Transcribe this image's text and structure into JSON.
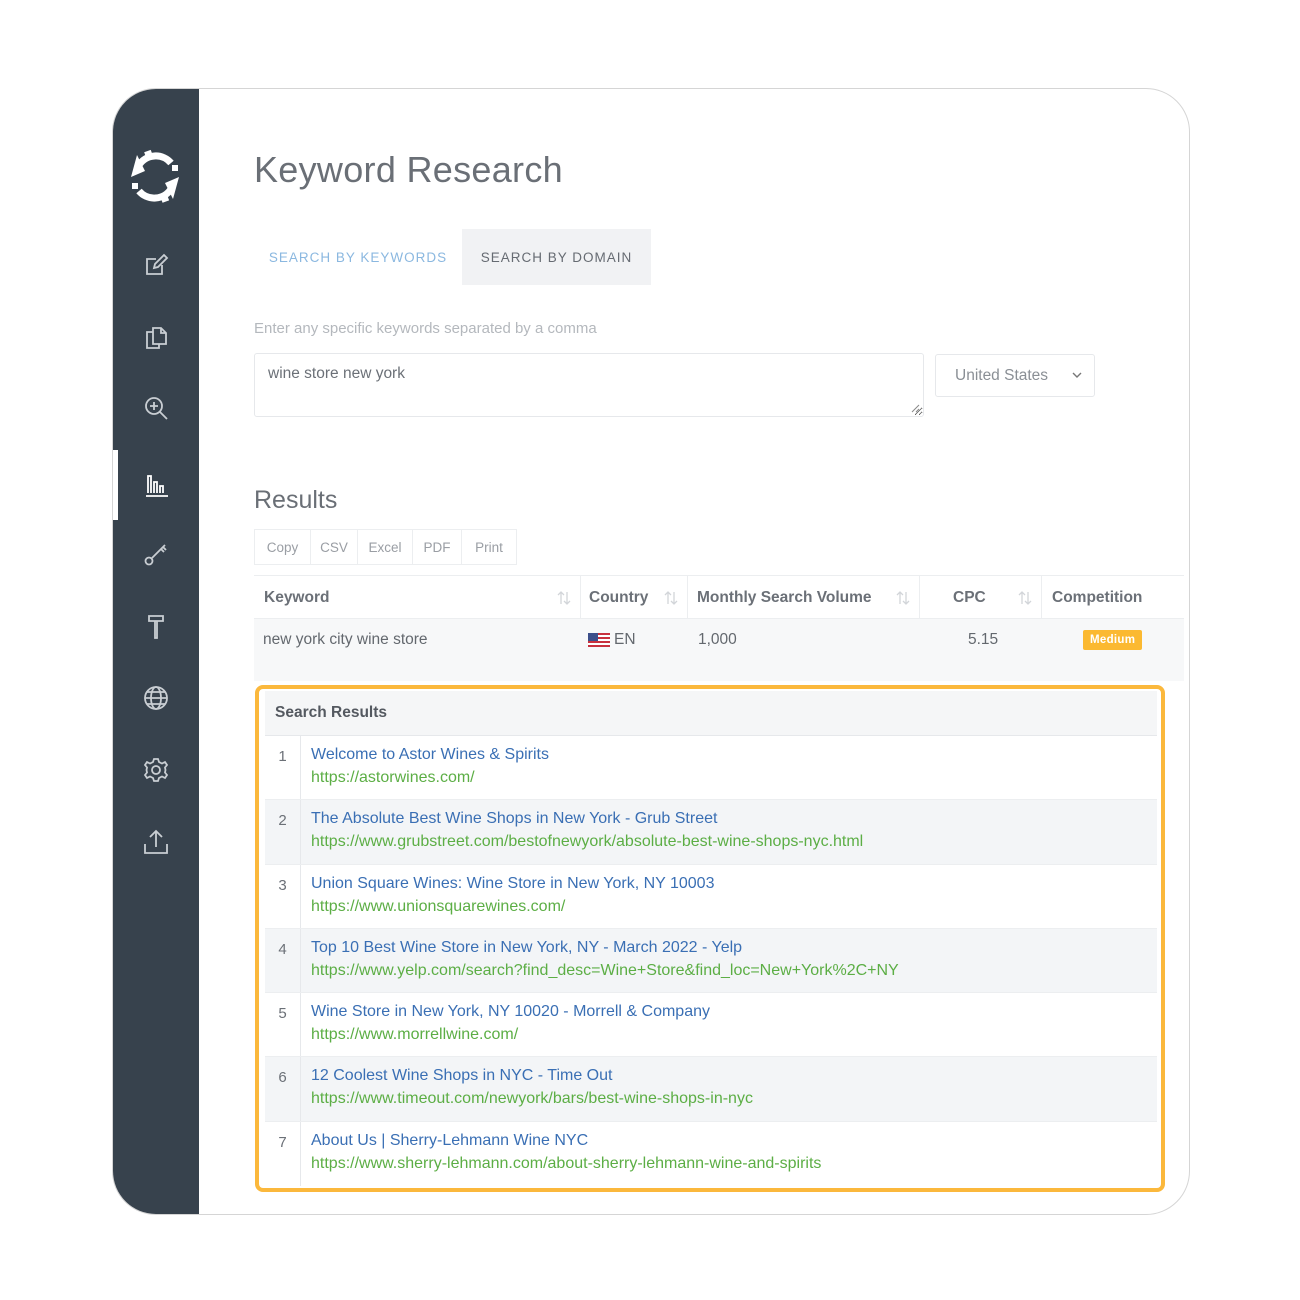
{
  "colors": {
    "sidebar_bg": "#37424d",
    "accent_link": "#3a6fb4",
    "url_green": "#5cae45",
    "highlight_border": "#fbb83c",
    "badge_medium": "#fbb931",
    "tab_active": "#8bb8e0"
  },
  "sidebar": {
    "logo_icon": "gear-sync-logo-icon",
    "items": [
      {
        "icon": "edit-icon",
        "active": false
      },
      {
        "icon": "copy-documents-icon",
        "active": false
      },
      {
        "icon": "zoom-in-icon",
        "active": false
      },
      {
        "icon": "bar-chart-icon",
        "active": true
      },
      {
        "icon": "key-icon",
        "active": false
      },
      {
        "icon": "hammer-icon",
        "active": false
      },
      {
        "icon": "globe-icon",
        "active": false
      },
      {
        "icon": "gear-icon",
        "active": false
      },
      {
        "icon": "upload-icon",
        "active": false
      }
    ]
  },
  "page": {
    "title": "Keyword Research",
    "tabs": [
      {
        "label": "SEARCH BY KEYWORDS",
        "active": true
      },
      {
        "label": "SEARCH BY DOMAIN",
        "active": false
      }
    ],
    "hint": "Enter any specific keywords separated by a comma",
    "keyword_input_value": "wine store new york",
    "country_select_value": "United States"
  },
  "results": {
    "title": "Results",
    "export_buttons": [
      "Copy",
      "CSV",
      "Excel",
      "PDF",
      "Print"
    ],
    "columns": [
      "Keyword",
      "Country",
      "Monthly Search Volume",
      "CPC",
      "Competition"
    ],
    "row": {
      "keyword": "new york city wine store",
      "country": "EN",
      "monthly_search_volume": "1,000",
      "cpc": "5.15",
      "competition": "Medium"
    }
  },
  "search_results": {
    "title": "Search Results",
    "items": [
      {
        "num": "1",
        "title": "Welcome to Astor Wines & Spirits",
        "url": "https://astorwines.com/"
      },
      {
        "num": "2",
        "title": "The Absolute Best Wine Shops in New York - Grub Street",
        "url": "https://www.grubstreet.com/bestofnewyork/absolute-best-wine-shops-nyc.html"
      },
      {
        "num": "3",
        "title": "Union Square Wines: Wine Store in New York, NY 10003",
        "url": "https://www.unionsquarewines.com/"
      },
      {
        "num": "4",
        "title": "Top 10 Best Wine Store in New York, NY - March 2022 - Yelp",
        "url": "https://www.yelp.com/search?find_desc=Wine+Store&find_loc=New+York%2C+NY"
      },
      {
        "num": "5",
        "title": "Wine Store in New York, NY 10020 - Morrell & Company",
        "url": "https://www.morrellwine.com/"
      },
      {
        "num": "6",
        "title": "12 Coolest Wine Shops in NYC - Time Out",
        "url": "https://www.timeout.com/newyork/bars/best-wine-shops-in-nyc"
      },
      {
        "num": "7",
        "title": "About Us | Sherry-Lehmann Wine NYC",
        "url": "https://www.sherry-lehmann.com/about-sherry-lehmann-wine-and-spirits"
      }
    ]
  }
}
